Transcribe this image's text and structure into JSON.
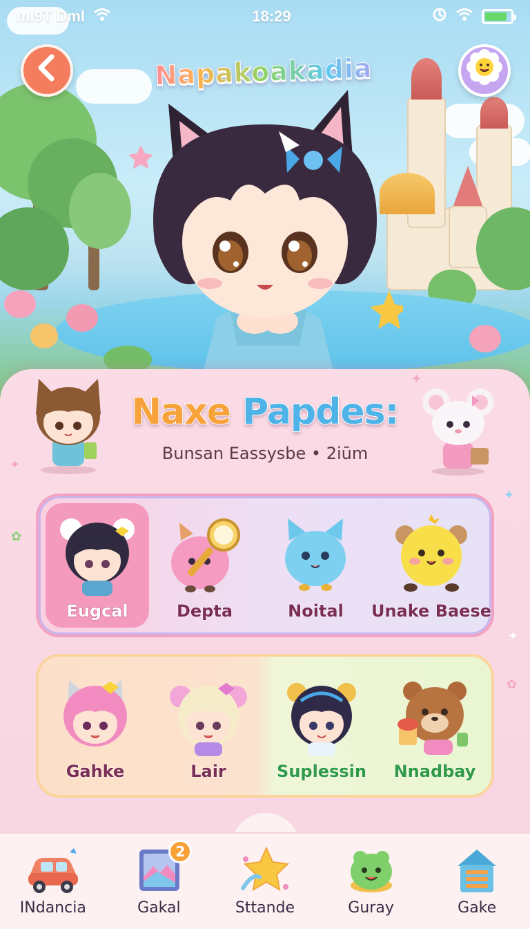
{
  "status_bar": {
    "carrier": "ml9T Dml",
    "time": "18:29",
    "battery_level": 0.85,
    "wifi_icon": "wifi-icon",
    "sync_icon": "sync-icon"
  },
  "header": {
    "game_title": "Napakoakadia",
    "back_icon": "chevron-left-icon",
    "profile_icon": "smiley-flower-icon"
  },
  "panel": {
    "title_part1": "Naxe",
    "title_part2": "Papdes:",
    "subtitle": "Bunsan Eassysbe • 2iūm"
  },
  "characters_row1": [
    {
      "name": "Eugcal",
      "selected": true
    },
    {
      "name": "Depta",
      "selected": false
    },
    {
      "name": "Noital",
      "selected": false
    },
    {
      "name": "Unake Baese",
      "selected": false
    }
  ],
  "characters_row2": [
    {
      "name": "Gahke"
    },
    {
      "name": "Lair"
    },
    {
      "name": "Suplessin"
    },
    {
      "name": "Nnadbay"
    }
  ],
  "nav": [
    {
      "label": "INdancia",
      "icon": "car-icon"
    },
    {
      "label": "Gakal",
      "icon": "gallery-icon",
      "badge": "2"
    },
    {
      "label": "Sttande",
      "icon": "star-icon"
    },
    {
      "label": "Guray",
      "icon": "frog-icon"
    },
    {
      "label": "Gake",
      "icon": "house-icon"
    }
  ],
  "colors": {
    "accent_pink": "#f49bbd",
    "accent_orange": "#f7a23a",
    "accent_blue": "#4fb3e8",
    "badge": "#f7a236"
  }
}
